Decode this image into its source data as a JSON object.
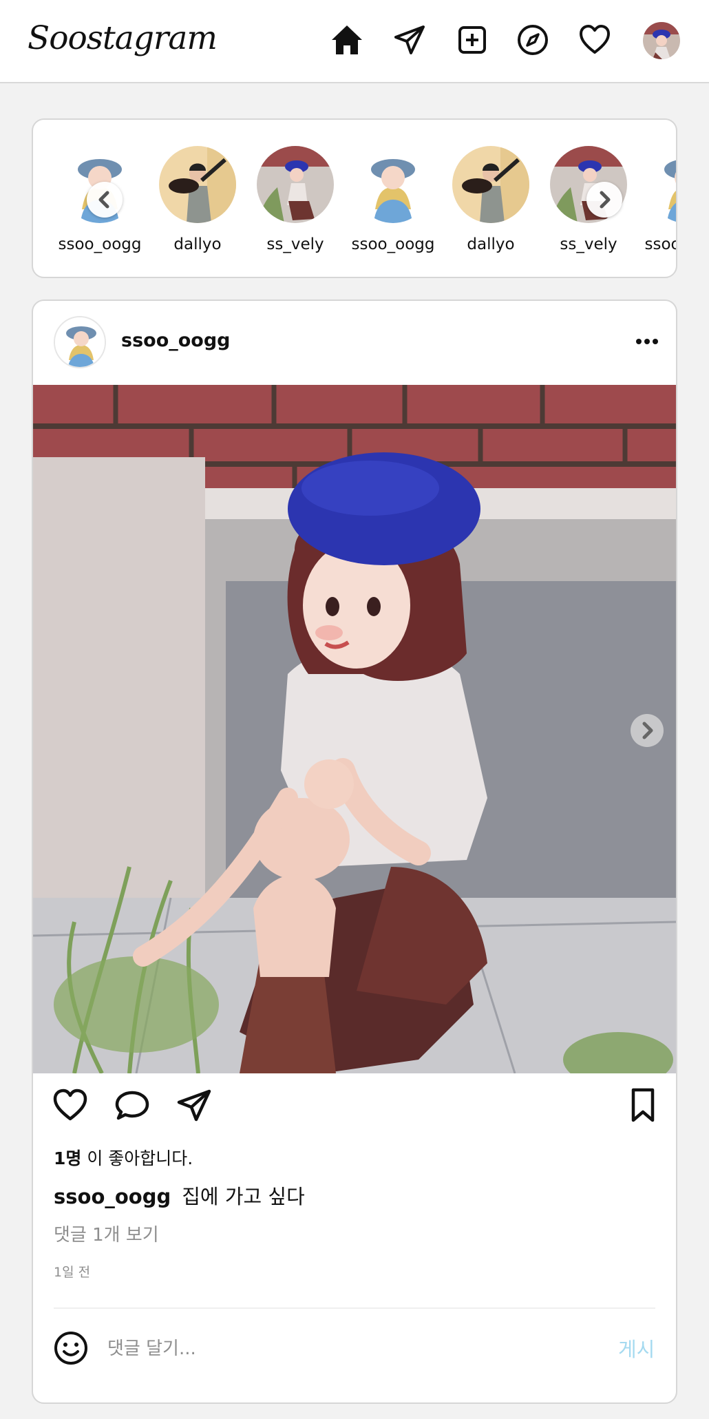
{
  "app": {
    "logo": "Soostagram"
  },
  "nav": {
    "icons": [
      "home-icon",
      "direct-message-icon",
      "new-post-icon",
      "explore-compass-icon",
      "activity-heart-icon"
    ]
  },
  "stories": {
    "items": [
      {
        "name": "ssoo_oogg",
        "avatar": "girl-blue-hat"
      },
      {
        "name": "dallyo",
        "avatar": "guitar-player"
      },
      {
        "name": "ss_vely",
        "avatar": "girl-beret"
      },
      {
        "name": "ssoo_oogg",
        "avatar": "girl-blue-hat"
      },
      {
        "name": "dallyo",
        "avatar": "guitar-player"
      },
      {
        "name": "ss_vely",
        "avatar": "girl-beret"
      },
      {
        "name": "ssoo_oogg",
        "avatar": "girl-blue-hat"
      }
    ]
  },
  "post": {
    "username": "ssoo_oogg",
    "likes_count": "1명",
    "likes_suffix": " 이 좋아합니다.",
    "caption_user": "ssoo_oogg",
    "caption_text": "집에 가고 싶다",
    "view_comments": "댓글 1개 보기",
    "time_ago": "1일 전",
    "comment_placeholder": "댓글 달기...",
    "post_button": "게시"
  },
  "colors": {
    "post_button_disabled": "#a5daf0",
    "muted_text": "#8e8e8e",
    "beret_blue": "#2c35b0"
  }
}
